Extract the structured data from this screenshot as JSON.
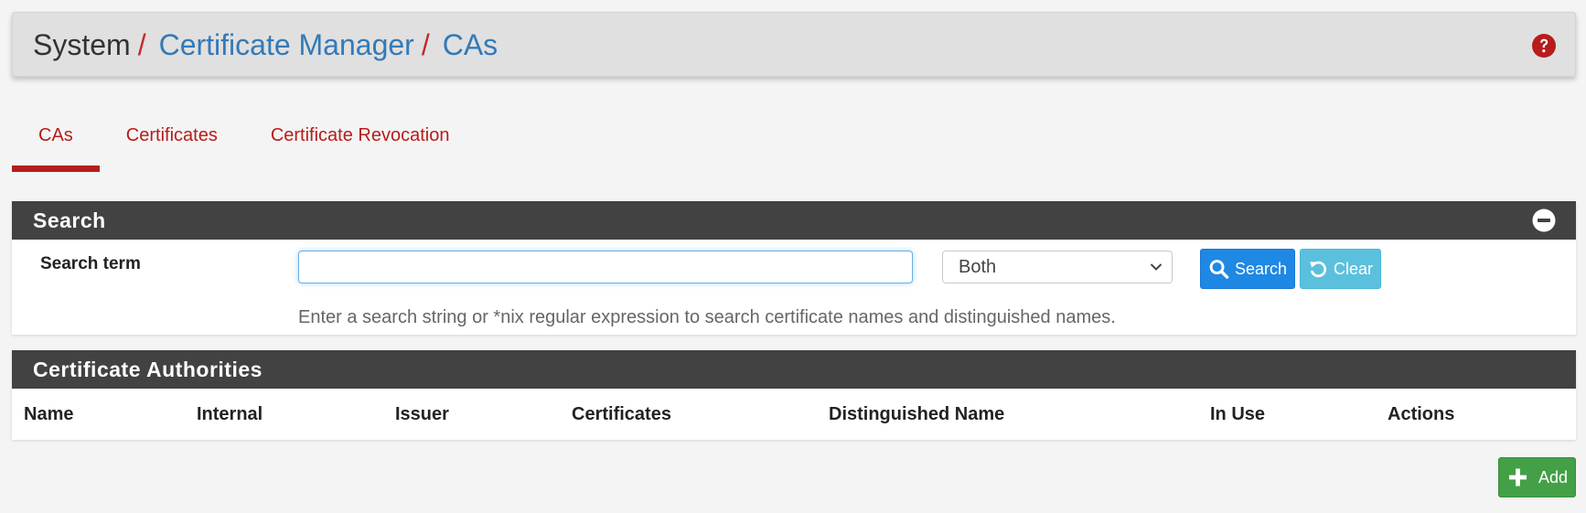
{
  "breadcrumb": {
    "root": "System",
    "separator": "/",
    "items": [
      "Certificate Manager",
      "CAs"
    ],
    "help_icon": "question-circle-icon"
  },
  "tabs": [
    {
      "label": "CAs",
      "active": true
    },
    {
      "label": "Certificates",
      "active": false
    },
    {
      "label": "Certificate Revocation",
      "active": false
    }
  ],
  "search_panel": {
    "title": "Search",
    "collapse_icon": "minus-circle-icon",
    "term_label": "Search term",
    "input_value": "",
    "select_value": "Both",
    "search_button": "Search",
    "clear_button": "Clear",
    "help_text": "Enter a search string or *nix regular expression to search certificate names and distinguished names."
  },
  "ca_panel": {
    "title": "Certificate Authorities",
    "columns": [
      "Name",
      "Internal",
      "Issuer",
      "Certificates",
      "Distinguished Name",
      "In Use",
      "Actions"
    ],
    "rows": []
  },
  "add_button": "Add",
  "colors": {
    "accent_red": "#b71c1c",
    "link_blue": "#337ab7",
    "panel_heading": "#424242",
    "search_button": "#1e88e5",
    "clear_button": "#5bc0de",
    "add_button": "#43a047"
  }
}
